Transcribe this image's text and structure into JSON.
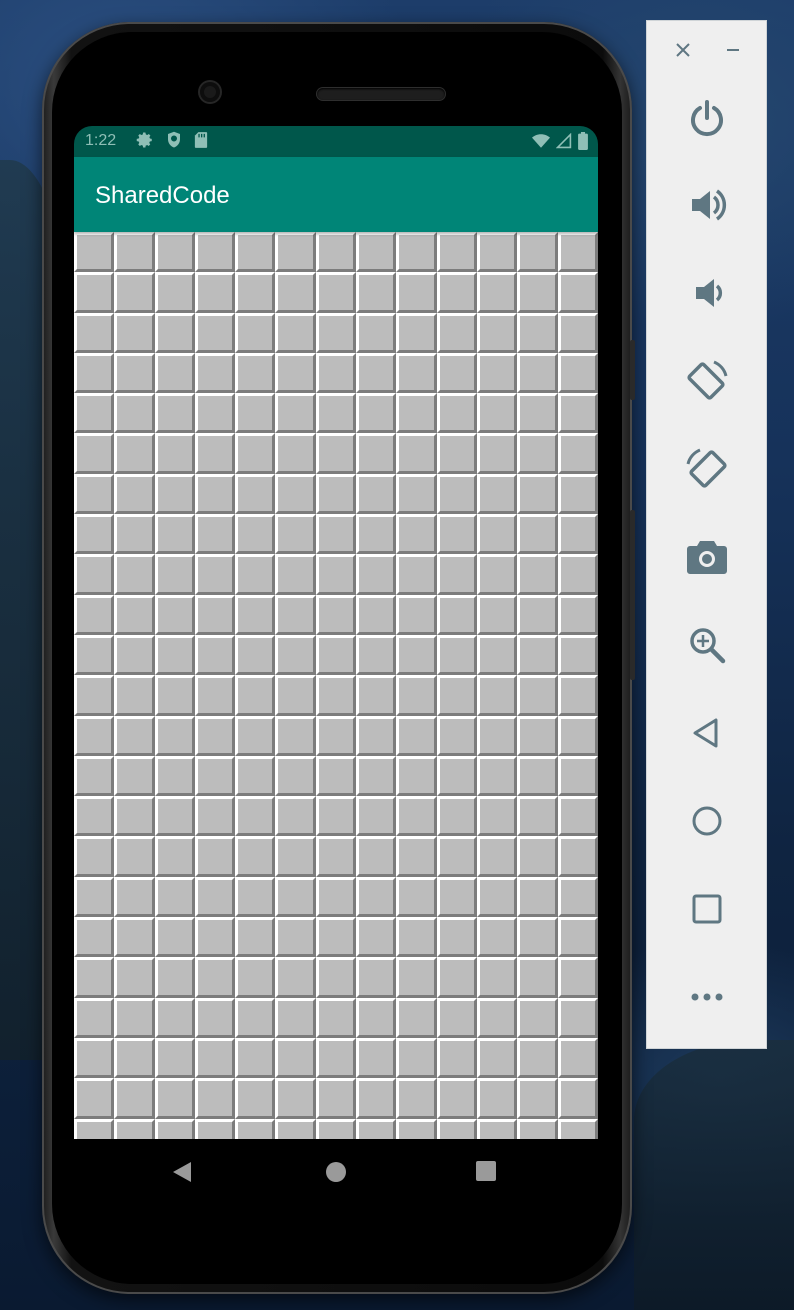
{
  "status_bar": {
    "time": "1:22",
    "left_icons": [
      "gear-icon",
      "shield-icon",
      "sd-card-icon"
    ],
    "right_icons": [
      "wifi-icon",
      "cell-signal-icon",
      "battery-icon"
    ]
  },
  "app": {
    "title": "SharedCode",
    "colors": {
      "status_bar": "#00574b",
      "toolbar": "#008577",
      "tile": "#bcbcbc",
      "tile_highlight": "#ffffff",
      "tile_shadow": "#7c7c7c"
    },
    "grid": {
      "columns": 13,
      "visible_rows": 23,
      "tile_state": "unrevealed"
    }
  },
  "nav_bar": {
    "buttons": [
      "back-icon",
      "home-icon",
      "recents-icon"
    ]
  },
  "emulator_panel": {
    "window_controls": [
      "close-icon",
      "minimize-icon"
    ],
    "buttons": [
      "power-icon",
      "volume-up-icon",
      "volume-down-icon",
      "rotate-left-icon",
      "rotate-right-icon",
      "camera-icon",
      "zoom-icon",
      "back-icon",
      "home-icon",
      "overview-icon",
      "more-icon"
    ],
    "icon_color": "#5f7782"
  }
}
